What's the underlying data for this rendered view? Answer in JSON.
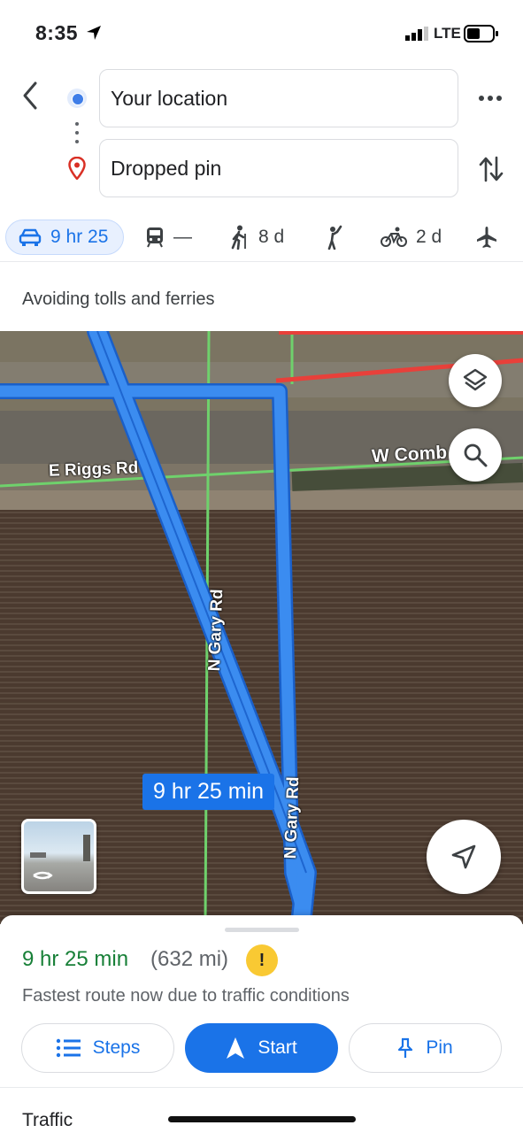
{
  "status_bar": {
    "time": "8:35",
    "network": "LTE"
  },
  "directions": {
    "origin": "Your location",
    "destination": "Dropped pin"
  },
  "modes": [
    {
      "name": "car",
      "label": "9 hr 25",
      "active": true
    },
    {
      "name": "transit",
      "label": "—"
    },
    {
      "name": "walk",
      "label": "8 d"
    },
    {
      "name": "rideshare",
      "label": ""
    },
    {
      "name": "bike",
      "label": "2 d"
    },
    {
      "name": "flight",
      "label": ""
    }
  ],
  "route_options_note": "Avoiding tolls and ferries",
  "map": {
    "labels": {
      "road1": "E Riggs Rd",
      "road2": "W Comb",
      "road3": "N Gary Rd",
      "road4": "N Gary Rd"
    },
    "route_tag": "9 hr 25 min"
  },
  "sheet": {
    "duration": "9 hr 25 min",
    "distance": "(632 mi)",
    "warning_icon": "!",
    "note": "Fastest route now due to traffic conditions",
    "buttons": {
      "steps": "Steps",
      "start": "Start",
      "pin": "Pin"
    },
    "traffic_heading": "Traffic"
  },
  "colors": {
    "accent": "#1a73e8",
    "route": "#3b8cf0",
    "duration_green": "#188038"
  }
}
